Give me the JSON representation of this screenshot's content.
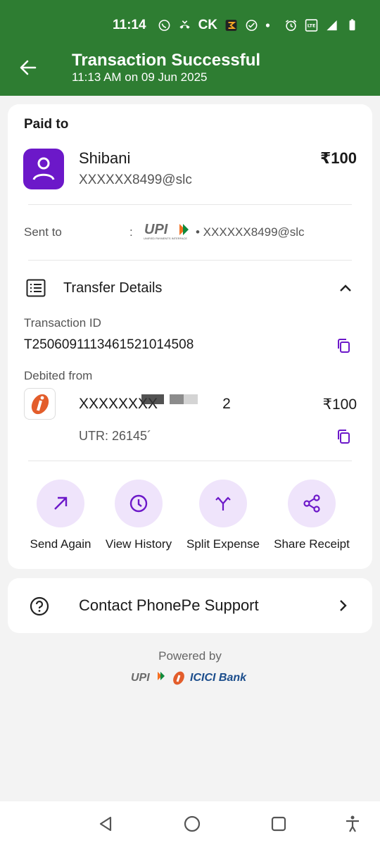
{
  "status_bar": {
    "time": "11:14",
    "carrier_text": "CK",
    "network": "5G"
  },
  "header": {
    "title": "Transaction Successful",
    "subtitle": "11:13 AM on 09 Jun 2025",
    "bg_color": "#2e7d32"
  },
  "paid_to": {
    "heading": "Paid to",
    "name": "Shibani",
    "vpa": "XXXXXX8499@slc",
    "amount": "₹100",
    "avatar_color": "#6c18c9"
  },
  "sent_to": {
    "label": "Sent to",
    "separator": ":",
    "logo_text": "UPI",
    "logo_subtext": "UNIFIED PAYMENTS INTERFACE",
    "vpa": "• XXXXXX8499@slc"
  },
  "transfer_details": {
    "label": "Transfer Details",
    "transaction_id_label": "Transaction ID",
    "transaction_id": "T2506091113461521014508",
    "debited_from_label": "Debited from",
    "account": "XXXXXXXX",
    "account_tail": "2",
    "amount": "₹100",
    "utr": "UTR: 26145´"
  },
  "actions": [
    {
      "label": "Send Again",
      "icon": "arrow-up-right-icon"
    },
    {
      "label": "View History",
      "icon": "clock-icon"
    },
    {
      "label": "Split Expense",
      "icon": "split-icon"
    },
    {
      "label": "Share Receipt",
      "icon": "share-icon"
    }
  ],
  "support": {
    "label": "Contact PhonePe Support"
  },
  "footer": {
    "powered_by": "Powered by",
    "upi_text": "UPI",
    "bank_name": "ICICI Bank"
  },
  "accent_color": "#6c18c9"
}
